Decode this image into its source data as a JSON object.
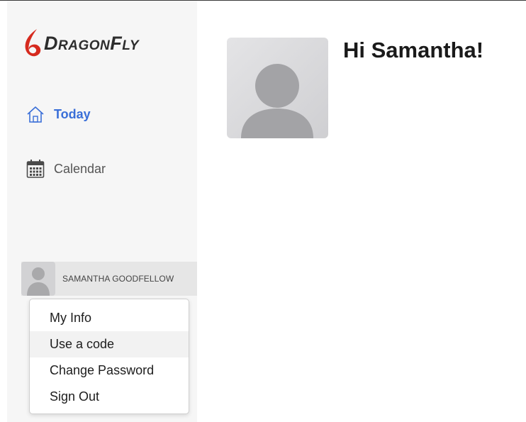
{
  "brand": {
    "logo_text": "DragonFly",
    "accent_color": "#d62a1e"
  },
  "nav": {
    "items": [
      {
        "label": "Today",
        "icon": "home-icon",
        "active": true
      },
      {
        "label": "Calendar",
        "icon": "calendar-icon",
        "active": false
      }
    ]
  },
  "user": {
    "name": "SAMANTHA GOODFELLOW"
  },
  "user_menu": {
    "items": [
      "My Info",
      "Use a code",
      "Change Password",
      "Sign Out"
    ],
    "highlighted_index": 1
  },
  "main": {
    "greeting": "Hi Samantha!"
  },
  "colors": {
    "active_nav": "#3a6fd8",
    "sidebar_bg": "#f6f6f6",
    "avatar_bg": "#d2d2d4"
  }
}
